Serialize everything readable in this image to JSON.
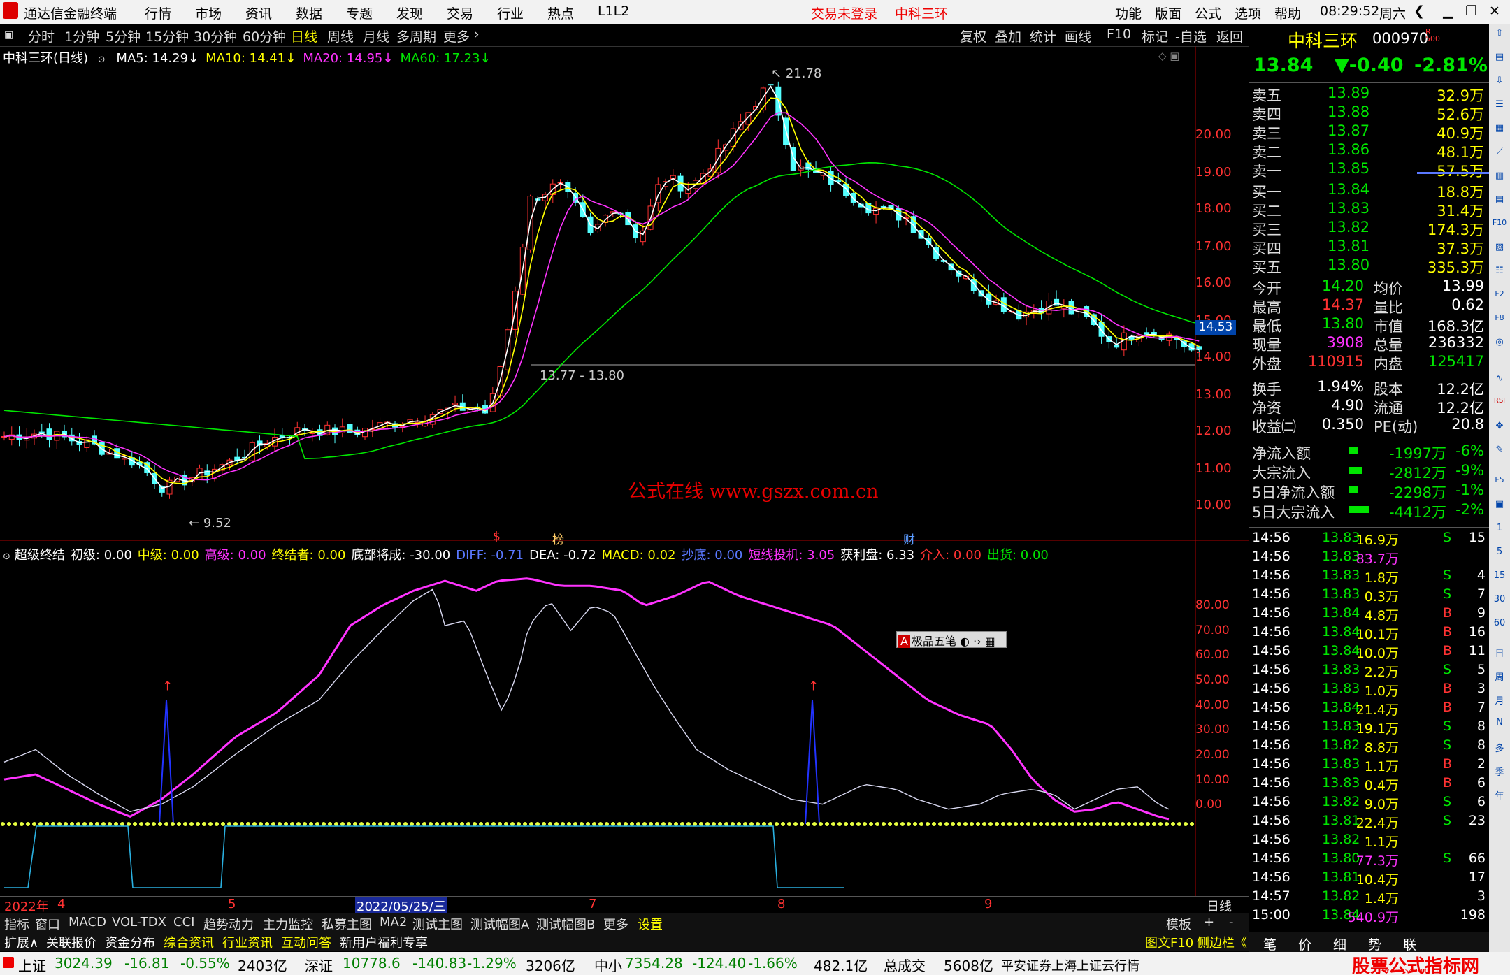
{
  "app": {
    "title": "通达信金融终端",
    "menus": [
      "行情",
      "市场",
      "资讯",
      "数据",
      "专题",
      "发现",
      "交易",
      "行业",
      "热点",
      "L1L2"
    ],
    "login_status": "交易未登录",
    "stock_name_top": "中科三环",
    "right_menus": [
      "功能",
      "版面",
      "公式",
      "选项",
      "帮助"
    ],
    "time": "08:29:52",
    "weekday": "周六"
  },
  "periods": [
    "分时",
    "1分钟",
    "5分钟",
    "15分钟",
    "30分钟",
    "60分钟",
    "日线",
    "周线",
    "月线",
    "多周期",
    "更多"
  ],
  "tools": [
    "复权",
    "叠加",
    "统计",
    "画线",
    "F10",
    "标记",
    "-自选",
    "返回"
  ],
  "main_chart": {
    "title": "中科三环(日线)",
    "ma_legend": [
      {
        "label": "MA5: 14.29",
        "color": "#ffffff"
      },
      {
        "label": "MA10: 14.41",
        "color": "#ffff00"
      },
      {
        "label": "MA20: 14.95",
        "color": "#ff33ff"
      },
      {
        "label": "MA60: 17.23",
        "color": "#00e600"
      }
    ],
    "price_ticks": [
      "20.00",
      "19.00",
      "18.00",
      "17.00",
      "16.00",
      "15.00",
      "14.00",
      "13.00",
      "12.00",
      "11.00",
      "10.00"
    ],
    "current_price_tag": "14.53",
    "high_label": "21.78",
    "low_label": "9.52",
    "line_label": "13.77 - 13.80",
    "watermark": "公式在线  www.gszx.com.cn",
    "markers": [
      "$",
      "榜",
      "财"
    ]
  },
  "indicator": {
    "legend": [
      {
        "label": "超级终结",
        "color": "#ffffff"
      },
      {
        "label": "初级: 0.00",
        "color": "#ffffff"
      },
      {
        "label": "中级: 0.00",
        "color": "#ffff00"
      },
      {
        "label": "高级: 0.00",
        "color": "#ff33ff"
      },
      {
        "label": "终结者: 0.00",
        "color": "#ffff00"
      },
      {
        "label": "底部将成: -30.00",
        "color": "#ffffff"
      },
      {
        "label": "DIFF: -0.71",
        "color": "#5a78ff"
      },
      {
        "label": "DEA: -0.72",
        "color": "#ffffff"
      },
      {
        "label": "MACD: 0.02",
        "color": "#ffff00"
      },
      {
        "label": "抄底: 0.00",
        "color": "#5a78ff"
      },
      {
        "label": "短线投机: 3.05",
        "color": "#ff33ff"
      },
      {
        "label": "获利盘: 6.33",
        "color": "#ffffff"
      },
      {
        "label": "介入: 0.00",
        "color": "#ff3232"
      },
      {
        "label": "出货: 0.00",
        "color": "#00e600"
      }
    ],
    "ticks": [
      "80.00",
      "70.00",
      "60.00",
      "50.00",
      "40.00",
      "30.00",
      "20.00",
      "10.00",
      "0.00"
    ],
    "toolbar_label": "极品五笔"
  },
  "time_axis": {
    "labels": [
      "2022年",
      "4",
      "5",
      "2022/05/25/三",
      "7",
      "8",
      "9"
    ],
    "period": "日线"
  },
  "bottom_tabs": [
    "指标",
    "窗口",
    "MACD",
    "VOL-TDX",
    "CCI",
    "趋势动力",
    "主力监控",
    "私募主图",
    "MA2",
    "测试主图",
    "测试幅图A",
    "测试幅图B",
    "更多",
    "设置",
    "模板",
    "+",
    "-"
  ],
  "sub_tabs": [
    {
      "label": "扩展∧",
      "color": "#ffffff"
    },
    {
      "label": "关联报价",
      "color": "#ffffff"
    },
    {
      "label": "资金分布",
      "color": "#ffffff"
    },
    {
      "label": "综合资讯",
      "color": "#ffff00"
    },
    {
      "label": "行业资讯",
      "color": "#ffff00"
    },
    {
      "label": "互动问答",
      "color": "#ffff00"
    },
    {
      "label": "新用户福利专享",
      "color": "#ffffff"
    },
    {
      "label": "图文F10",
      "color": "#ffff00"
    },
    {
      "label": "侧边栏《",
      "color": "#ffff00"
    }
  ],
  "right_panel": {
    "name": "中科三环",
    "code": "000970",
    "price": "13.84",
    "change": "▼-0.40",
    "pct": "-2.81%",
    "asks": [
      {
        "label": "卖五",
        "price": "13.89",
        "vol": "32.9万"
      },
      {
        "label": "卖四",
        "price": "13.88",
        "vol": "52.6万"
      },
      {
        "label": "卖三",
        "price": "13.87",
        "vol": "40.9万"
      },
      {
        "label": "卖二",
        "price": "13.86",
        "vol": "48.1万"
      },
      {
        "label": "卖一",
        "price": "13.85",
        "vol": "57.5万"
      }
    ],
    "bids": [
      {
        "label": "买一",
        "price": "13.84",
        "vol": "18.8万"
      },
      {
        "label": "买二",
        "price": "13.83",
        "vol": "31.4万"
      },
      {
        "label": "买三",
        "price": "13.82",
        "vol": "174.3万"
      },
      {
        "label": "买四",
        "price": "13.81",
        "vol": "37.3万"
      },
      {
        "label": "买五",
        "price": "13.80",
        "vol": "335.3万"
      }
    ],
    "stats": [
      [
        "今开",
        "14.20",
        "均价",
        "13.99"
      ],
      [
        "最高",
        "14.37",
        "量比",
        "0.62"
      ],
      [
        "最低",
        "13.80",
        "市值",
        "168.3亿"
      ],
      [
        "现量",
        "3908",
        "总量",
        "236332"
      ],
      [
        "外盘",
        "110915",
        "内盘",
        "125417"
      ],
      [
        "换手",
        "1.94%",
        "股本",
        "12.2亿"
      ],
      [
        "净资",
        "4.90",
        "流通",
        "12.2亿"
      ],
      [
        "收益㈡",
        "0.350",
        "PE(动)",
        "20.8"
      ]
    ],
    "flows": [
      [
        "净流入额",
        "-1997万",
        "-6%"
      ],
      [
        "大宗流入",
        "-2812万",
        "-9%"
      ],
      [
        "5日净流入额",
        "-2298万",
        "-1%"
      ],
      [
        "5日大宗流入",
        "-4412万",
        "-2%"
      ]
    ],
    "ticks": [
      [
        "14:56",
        "13.83",
        "16.9万",
        "S",
        "15"
      ],
      [
        "14:56",
        "13.83",
        "83.7万",
        "",
        ""
      ],
      [
        "14:56",
        "13.83",
        "1.8万",
        "S",
        "4"
      ],
      [
        "14:56",
        "13.83",
        "0.3万",
        "S",
        "7"
      ],
      [
        "14:56",
        "13.84",
        "4.8万",
        "B",
        "9"
      ],
      [
        "14:56",
        "13.84",
        "10.1万",
        "B",
        "16"
      ],
      [
        "14:56",
        "13.84",
        "10.0万",
        "B",
        "11"
      ],
      [
        "14:56",
        "13.83",
        "2.2万",
        "S",
        "5"
      ],
      [
        "14:56",
        "13.83",
        "1.0万",
        "B",
        "3"
      ],
      [
        "14:56",
        "13.84",
        "21.4万",
        "B",
        "7"
      ],
      [
        "14:56",
        "13.83",
        "19.1万",
        "S",
        "8"
      ],
      [
        "14:56",
        "13.82",
        "8.8万",
        "S",
        "8"
      ],
      [
        "14:56",
        "13.83",
        "1.1万",
        "B",
        "2"
      ],
      [
        "14:56",
        "13.83",
        "0.4万",
        "B",
        "6"
      ],
      [
        "14:56",
        "13.82",
        "9.0万",
        "S",
        "6"
      ],
      [
        "14:56",
        "13.81",
        "22.4万",
        "S",
        "23"
      ],
      [
        "14:56",
        "13.82",
        "1.1万",
        "",
        ""
      ],
      [
        "14:56",
        "13.80",
        "77.3万",
        "S",
        "66"
      ],
      [
        "14:56",
        "13.81",
        "10.4万",
        "",
        "17"
      ],
      [
        "14:57",
        "13.82",
        "1.4万",
        "",
        "3"
      ],
      [
        "15:00",
        "13.84",
        "540.9万",
        "",
        "198"
      ]
    ],
    "bottom_tabs": [
      "笔",
      "价",
      "细",
      "势",
      "联"
    ]
  },
  "status": {
    "sh_label": "上证",
    "sh_val": "3024.39",
    "sh_chg": "-16.81",
    "sh_pct": "-0.55%",
    "sh_amt": "2403亿",
    "sz_label": "深证",
    "sz_val": "10778.6",
    "sz_chg": "-140.83",
    "sz_pct": "-1.29%",
    "sz_amt": "3206亿",
    "zx_label": "中小",
    "zx_val": "7354.28",
    "zx_chg": "-124.40",
    "zx_pct": "-1.66%",
    "zx_amt": "482.1亿",
    "total_label": "总成交",
    "total_amt": "5608亿",
    "broker": "平安证券上海上证云行情",
    "logo": "股票公式指标网",
    "logo_url": "www.gszx.com.cn"
  }
}
